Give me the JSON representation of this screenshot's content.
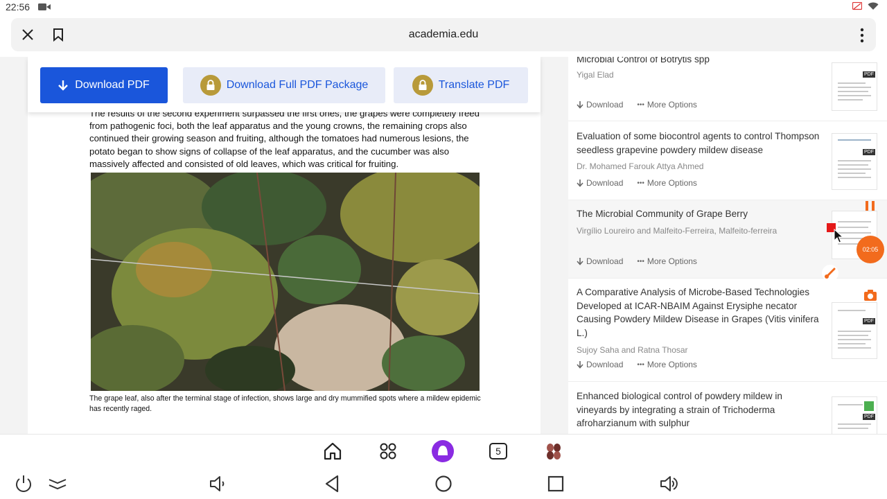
{
  "status_bar": {
    "time": "22:56",
    "icons": [
      "video-camera-icon",
      "cast-icon",
      "wifi-icon"
    ]
  },
  "browser": {
    "url": "academia.edu",
    "icons": [
      "close-icon",
      "bookmark-icon",
      "more-vert-icon"
    ]
  },
  "actions": {
    "download_pdf": "Download PDF",
    "download_full_package": "Download Full PDF Package",
    "translate_pdf": "Translate PDF"
  },
  "document": {
    "paragraph": "The results of the second experiment surpassed the first ones, the grapes were completely freed from pathogenic foci, both the leaf apparatus and the young crowns, the remaining crops also continued their growing season and fruiting, although the tomatoes had numerous lesions, the potato began to show signs of collapse of the leaf apparatus, and the cucumber was also massively affected and consisted of old leaves, which was critical for fruiting.",
    "caption": "The grape leaf, also after the terminal stage of infection, shows large and dry mummified spots where a mildew epidemic has recently raged."
  },
  "related": {
    "download_label": "Download",
    "more_options_label": "More Options",
    "pdf_badge": "PDF",
    "items": [
      {
        "title": "Microbial Control of Botrytis spp",
        "author": "Yigal Elad"
      },
      {
        "title": "Evaluation of some biocontrol agents to control Thompson seedless grapevine powdery mildew disease",
        "author": "Dr. Mohamed Farouk Attya Ahmed"
      },
      {
        "title": "The Microbial Community of Grape Berry",
        "author": "Virgílio Loureiro and Malfeito-Ferreira, Malfeito-ferreira"
      },
      {
        "title": "A Comparative Analysis of Microbe-Based Technologies Developed at ICAR-NBAIM Against Erysiphe necator Causing Powdery Mildew Disease in Grapes (Vitis vinifera L.)",
        "author": "Sujoy Saha and Ratna Thosar"
      },
      {
        "title": "Enhanced biological control of powdery mildew in vineyards by integrating a strain of Trichoderma afroharzianum with sulphur",
        "author": ""
      }
    ]
  },
  "recorder": {
    "timer": "02:05",
    "accent": "#f26b1d"
  },
  "dock": {
    "tab_count": "5",
    "accent": "#8a2be2"
  },
  "colors": {
    "primary_blue": "#1a56db",
    "secondary_button_bg": "#e8ecf8",
    "lock_gold": "#b89a3a"
  }
}
